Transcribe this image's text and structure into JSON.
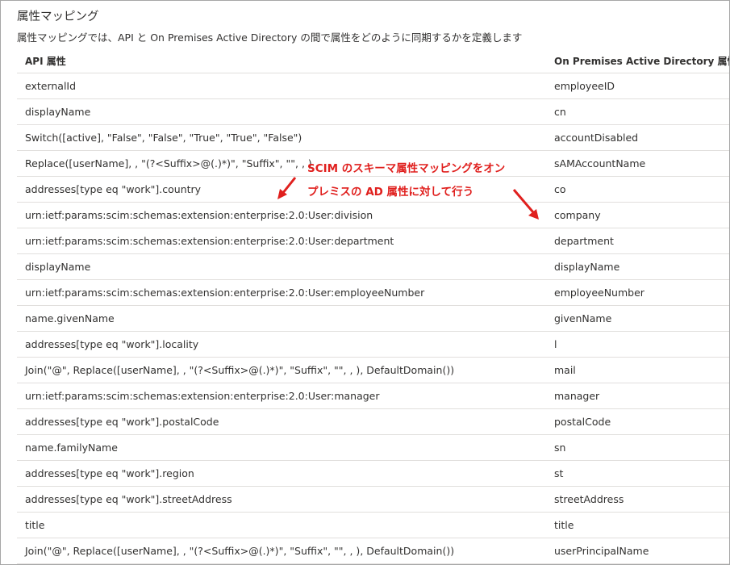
{
  "header": {
    "title": "属性マッピング",
    "description": "属性マッピングでは、API と On Premises Active Directory の間で属性をどのように同期するかを定義します"
  },
  "table": {
    "col_api": "API 属性",
    "col_ad": "On Premises Active Directory 属性",
    "rows": [
      {
        "api": "externalId",
        "ad": "employeeID"
      },
      {
        "api": "displayName",
        "ad": "cn"
      },
      {
        "api": "Switch([active], \"False\", \"False\", \"True\", \"True\", \"False\")",
        "ad": "accountDisabled"
      },
      {
        "api": "Replace([userName], , \"(?<Suffix>@(.)*)\", \"Suffix\", \"\", , )",
        "ad": "sAMAccountName"
      },
      {
        "api": "addresses[type eq \"work\"].country",
        "ad": "co"
      },
      {
        "api": "urn:ietf:params:scim:schemas:extension:enterprise:2.0:User:division",
        "ad": "company"
      },
      {
        "api": "urn:ietf:params:scim:schemas:extension:enterprise:2.0:User:department",
        "ad": "department"
      },
      {
        "api": "displayName",
        "ad": "displayName"
      },
      {
        "api": "urn:ietf:params:scim:schemas:extension:enterprise:2.0:User:employeeNumber",
        "ad": "employeeNumber"
      },
      {
        "api": "name.givenName",
        "ad": "givenName"
      },
      {
        "api": "addresses[type eq \"work\"].locality",
        "ad": "l"
      },
      {
        "api": "Join(\"@\", Replace([userName], , \"(?<Suffix>@(.)*)\", \"Suffix\", \"\", , ), DefaultDomain())",
        "ad": "mail"
      },
      {
        "api": "urn:ietf:params:scim:schemas:extension:enterprise:2.0:User:manager",
        "ad": "manager"
      },
      {
        "api": "addresses[type eq \"work\"].postalCode",
        "ad": "postalCode"
      },
      {
        "api": "name.familyName",
        "ad": "sn"
      },
      {
        "api": "addresses[type eq \"work\"].region",
        "ad": "st"
      },
      {
        "api": "addresses[type eq \"work\"].streetAddress",
        "ad": "streetAddress"
      },
      {
        "api": "title",
        "ad": "title"
      },
      {
        "api": "Join(\"@\", Replace([userName], , \"(?<Suffix>@(.)*)\", \"Suffix\", \"\", , ), DefaultDomain())",
        "ad": "userPrincipalName"
      }
    ]
  },
  "annotation": {
    "line1": "SCIM のスキーマ属性マッピングをオン",
    "line2": "プレミスの AD 属性に対して行う",
    "color": "#e0201e"
  }
}
